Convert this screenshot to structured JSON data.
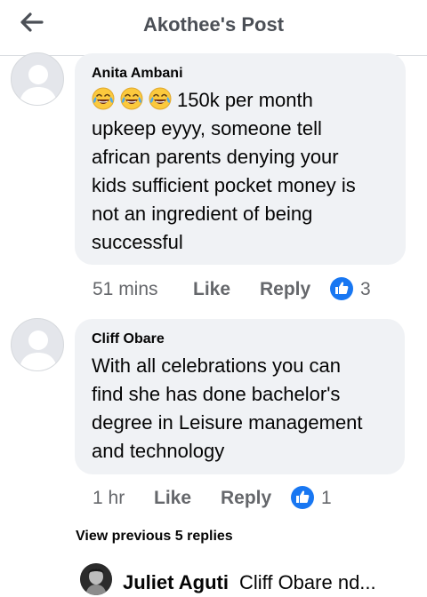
{
  "header": {
    "title": "Akothee's Post",
    "back_icon": "arrow-left-icon"
  },
  "comments": [
    {
      "author": "Anita Ambani",
      "emoji_icon": "face-with-tears-of-joy-icon",
      "emoji_count": 3,
      "lines": [
        "150k per month",
        "upkeep eyyy, someone tell",
        "african parents denying your",
        "kids sufficient pocket money is",
        "not an ingredient of being",
        "successful"
      ],
      "time": "51 mins",
      "like_label": "Like",
      "reply_label": "Reply",
      "reaction_count": "3"
    },
    {
      "author": "Cliff Obare",
      "lines": [
        "With all celebrations you can",
        "find she has done bachelor's",
        "degree in Leisure management",
        "and technology"
      ],
      "time": "1 hr",
      "like_label": "Like",
      "reply_label": "Reply",
      "reaction_count": "1"
    }
  ],
  "view_previous": "View previous 5 replies",
  "reply_preview": {
    "author": "Juliet Aguti",
    "text": "Cliff Obare nd..."
  },
  "colors": {
    "brand_blue": "#1877f2",
    "bubble": "#f0f2f5",
    "meta": "#65676b"
  }
}
